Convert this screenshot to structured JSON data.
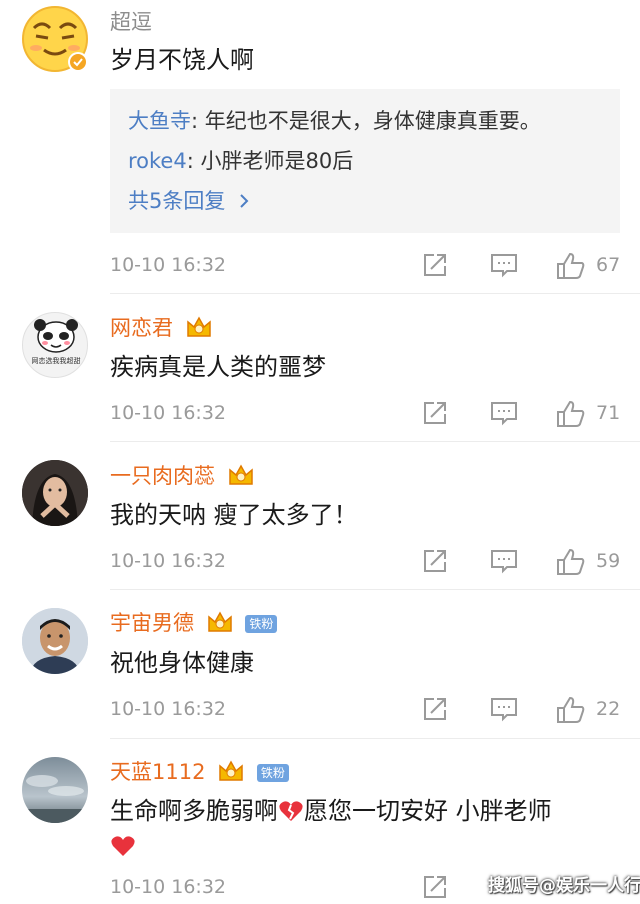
{
  "comments": [
    {
      "username": "超逗",
      "text": "岁月不饶人啊",
      "replies": [
        {
          "name": "大鱼寺",
          "text": ": 年纪也不是很大，身体健康真重要。"
        },
        {
          "name": "roke4",
          "text": ": 小胖老师是80后"
        }
      ],
      "more_replies": "共5条回复",
      "time": "10-10 16:32",
      "likes": "67"
    },
    {
      "username": "网恋君",
      "text": "疾病真是人类的噩梦",
      "avatar_text": "网恋选我我超甜",
      "time": "10-10 16:32",
      "likes": "71"
    },
    {
      "username": "一只肉肉蕊",
      "text": "我的天呐 瘦了太多了！",
      "time": "10-10 16:32",
      "likes": "59"
    },
    {
      "username": "宇宙男德",
      "badge": "铁粉",
      "text": "祝他身体健康",
      "time": "10-10 16:32",
      "likes": "22"
    },
    {
      "username": "天蓝1112",
      "badge": "铁粉",
      "text_part1": "生命啊多脆弱啊",
      "text_part2": "愿您一切安好 小胖老师",
      "time": "10-10 16:32"
    }
  ],
  "watermark": "搜狐号@娱乐一人行",
  "colors": {
    "vip_name": "#e86b1f",
    "plain_name": "#8d8d8d",
    "link": "#4d7ec4",
    "meta": "#9a9a9a",
    "reply_bg": "#f4f4f4",
    "heart": "#e8323c"
  },
  "icons": [
    "verified-badge-icon",
    "crown-icon",
    "share-icon",
    "comment-icon",
    "thumbs-up-icon",
    "chevron-right-icon",
    "broken-heart-icon",
    "red-heart-icon"
  ]
}
